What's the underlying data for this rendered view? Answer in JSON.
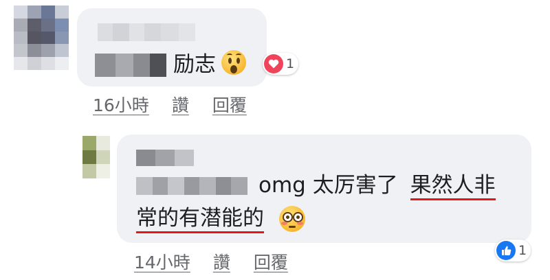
{
  "comment1": {
    "avatar": {
      "colors": [
        "#d5d8e0",
        "#9ea3b4",
        "#6a7796",
        "#c9cdd7",
        "#a9acb5",
        "#5e5d6a",
        "#6a7187",
        "#7c8fb2",
        "#b9bcc5",
        "#555661",
        "#55576a",
        "#8a97b2",
        "#c4c6cd",
        "#8c8e98",
        "#9da0ad",
        "#c0c5d2",
        "#e6e7eb",
        "#cfd1d7",
        "#dedfe4",
        "#eceef1"
      ]
    },
    "text": "励志",
    "reaction": {
      "type": "love",
      "count": "1",
      "color": "#f0445c"
    },
    "time": "16小時",
    "like_label": "讚",
    "reply_label": "回覆"
  },
  "comment2": {
    "avatar": {
      "colors": [
        "#9aa86a",
        "#e8eadd",
        "#6f7a42",
        "#cfd5b8",
        "#c2c9a4",
        "#eef0e6"
      ]
    },
    "text_start": "omg 太厉害了",
    "text_highlight_1": "果然人非",
    "text_highlight_2": "常的有潜能的",
    "highlight_color": "#e1171b",
    "reaction": {
      "type": "like",
      "count": "1",
      "color": "#1877f2"
    },
    "time": "14小時",
    "like_label": "讚",
    "reply_label": "回覆"
  }
}
